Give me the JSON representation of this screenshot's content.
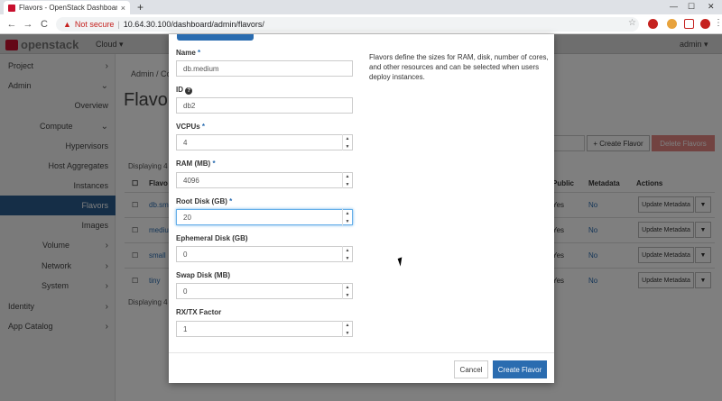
{
  "browser": {
    "tab_title": "Flavors - OpenStack Dashboard",
    "tab_close": "×",
    "new_tab": "+",
    "min": "—",
    "max": "☐",
    "close": "✕",
    "back": "←",
    "forward": "→",
    "reload": "C",
    "security_warning": "Not secure",
    "url": "10.64.30.100/dashboard/admin/flavors/",
    "menu": "⋮"
  },
  "header": {
    "logo": "openstack",
    "project_selector": "Cloud ▾",
    "user_menu": "admin ▾"
  },
  "sidebar": {
    "items": [
      {
        "label": "Project"
      },
      {
        "label": "Admin"
      },
      {
        "label": "Overview"
      },
      {
        "label": "Compute"
      },
      {
        "label": "Hypervisors"
      },
      {
        "label": "Host Aggregates"
      },
      {
        "label": "Instances"
      },
      {
        "label": "Flavors"
      },
      {
        "label": "Images"
      },
      {
        "label": "Volume"
      },
      {
        "label": "Network"
      },
      {
        "label": "System"
      },
      {
        "label": "Identity"
      },
      {
        "label": "App Catalog"
      }
    ]
  },
  "page": {
    "breadcrumb": "Admin / Co",
    "title": "Flavo",
    "create_button": "+ Create Flavor",
    "delete_button": "Delete Flavors",
    "displaying_top": "Displaying 4",
    "displaying_bottom": "Displaying 4",
    "columns": [
      "Flavo",
      "Public",
      "Metadata",
      "Actions"
    ],
    "rows": [
      {
        "name": "db.sm",
        "public": "Yes",
        "metadata": "No",
        "action": "Update Metadata"
      },
      {
        "name": "mediu",
        "public": "Yes",
        "metadata": "No",
        "action": "Update Metadata"
      },
      {
        "name": "small",
        "public": "Yes",
        "metadata": "No",
        "action": "Update Metadata"
      },
      {
        "name": "tiny",
        "public": "Yes",
        "metadata": "No",
        "action": "Update Metadata"
      }
    ]
  },
  "modal": {
    "fields": [
      {
        "label": "Name",
        "required": true,
        "value": "db.medium"
      },
      {
        "label": "ID",
        "required": false,
        "value": "db2"
      },
      {
        "label": "VCPUs",
        "required": true,
        "value": "4"
      },
      {
        "label": "RAM (MB)",
        "required": true,
        "value": "4096"
      },
      {
        "label": "Root Disk (GB)",
        "required": true,
        "value": "20"
      },
      {
        "label": "Ephemeral Disk (GB)",
        "required": false,
        "value": "0"
      },
      {
        "label": "Swap Disk (MB)",
        "required": false,
        "value": "0"
      },
      {
        "label": "RX/TX Factor",
        "required": false,
        "value": "1"
      }
    ],
    "required_marker": "*",
    "id_help_icon": "?",
    "help_text": "Flavors define the sizes for RAM, disk, number of cores, and other resources and can be selected when users deploy instances.",
    "cancel": "Cancel",
    "submit": "Create Flavor"
  },
  "colors": {
    "accent": "#2a6cb0",
    "sidebar_active": "#2a5d8f",
    "danger": "#d9534f"
  }
}
